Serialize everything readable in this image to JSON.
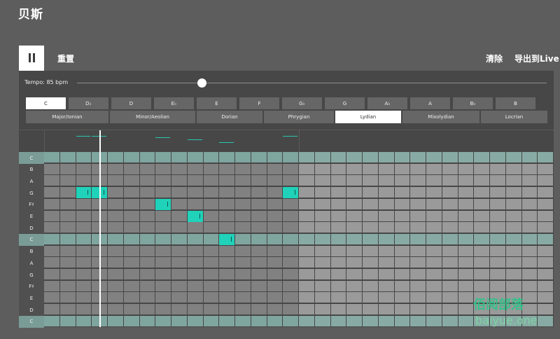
{
  "title": "贝斯",
  "toolbar": {
    "pause_icon": "pause-icon",
    "reset_label": "重置",
    "clear_label": "清除",
    "export_label": "导出到Live"
  },
  "tempo": {
    "label": "Tempo: 85 bpm",
    "value": 85,
    "position": 0.266
  },
  "keys": [
    {
      "label": "C",
      "selected": true
    },
    {
      "label": "D♭",
      "selected": false
    },
    {
      "label": "D",
      "selected": false
    },
    {
      "label": "E♭",
      "selected": false
    },
    {
      "label": "E",
      "selected": false
    },
    {
      "label": "F",
      "selected": false
    },
    {
      "label": "G♭",
      "selected": false
    },
    {
      "label": "G",
      "selected": false
    },
    {
      "label": "A♭",
      "selected": false
    },
    {
      "label": "A",
      "selected": false
    },
    {
      "label": "B♭",
      "selected": false
    },
    {
      "label": "B",
      "selected": false
    }
  ],
  "modes": [
    {
      "label": "Major/Ionian",
      "selected": false
    },
    {
      "label": "Minor/Aeolian",
      "selected": false
    },
    {
      "label": "Dorian",
      "selected": false
    },
    {
      "label": "Phrygian",
      "selected": false
    },
    {
      "label": "Lydian",
      "selected": true
    },
    {
      "label": "Mixolydian",
      "selected": false
    },
    {
      "label": "Locrian",
      "selected": false
    }
  ],
  "pitch_rows": [
    "C",
    "B",
    "A",
    "G",
    "F♯",
    "E",
    "D",
    "C",
    "B",
    "A",
    "G",
    "F♯",
    "E",
    "D",
    "C"
  ],
  "tonic_rows": [
    0,
    7,
    14
  ],
  "grid": {
    "steps": 32,
    "active_steps": 16,
    "playhead_step": 3.5
  },
  "notes": [
    {
      "row": 3,
      "step": 2
    },
    {
      "row": 3,
      "step": 3
    },
    {
      "row": 4,
      "step": 7
    },
    {
      "row": 5,
      "step": 9
    },
    {
      "row": 7,
      "step": 11
    },
    {
      "row": 3,
      "step": 15
    }
  ],
  "colors": {
    "note": "#1fd2b9",
    "tonic_row": "#7fa59f",
    "cell_active": "#818181",
    "cell_inactive": "#9a9a9a",
    "cell_tonic_inactive": "#88aaa4"
  },
  "watermark": {
    "line1": "佰阅部落",
    "line2": "baiyue.one"
  }
}
